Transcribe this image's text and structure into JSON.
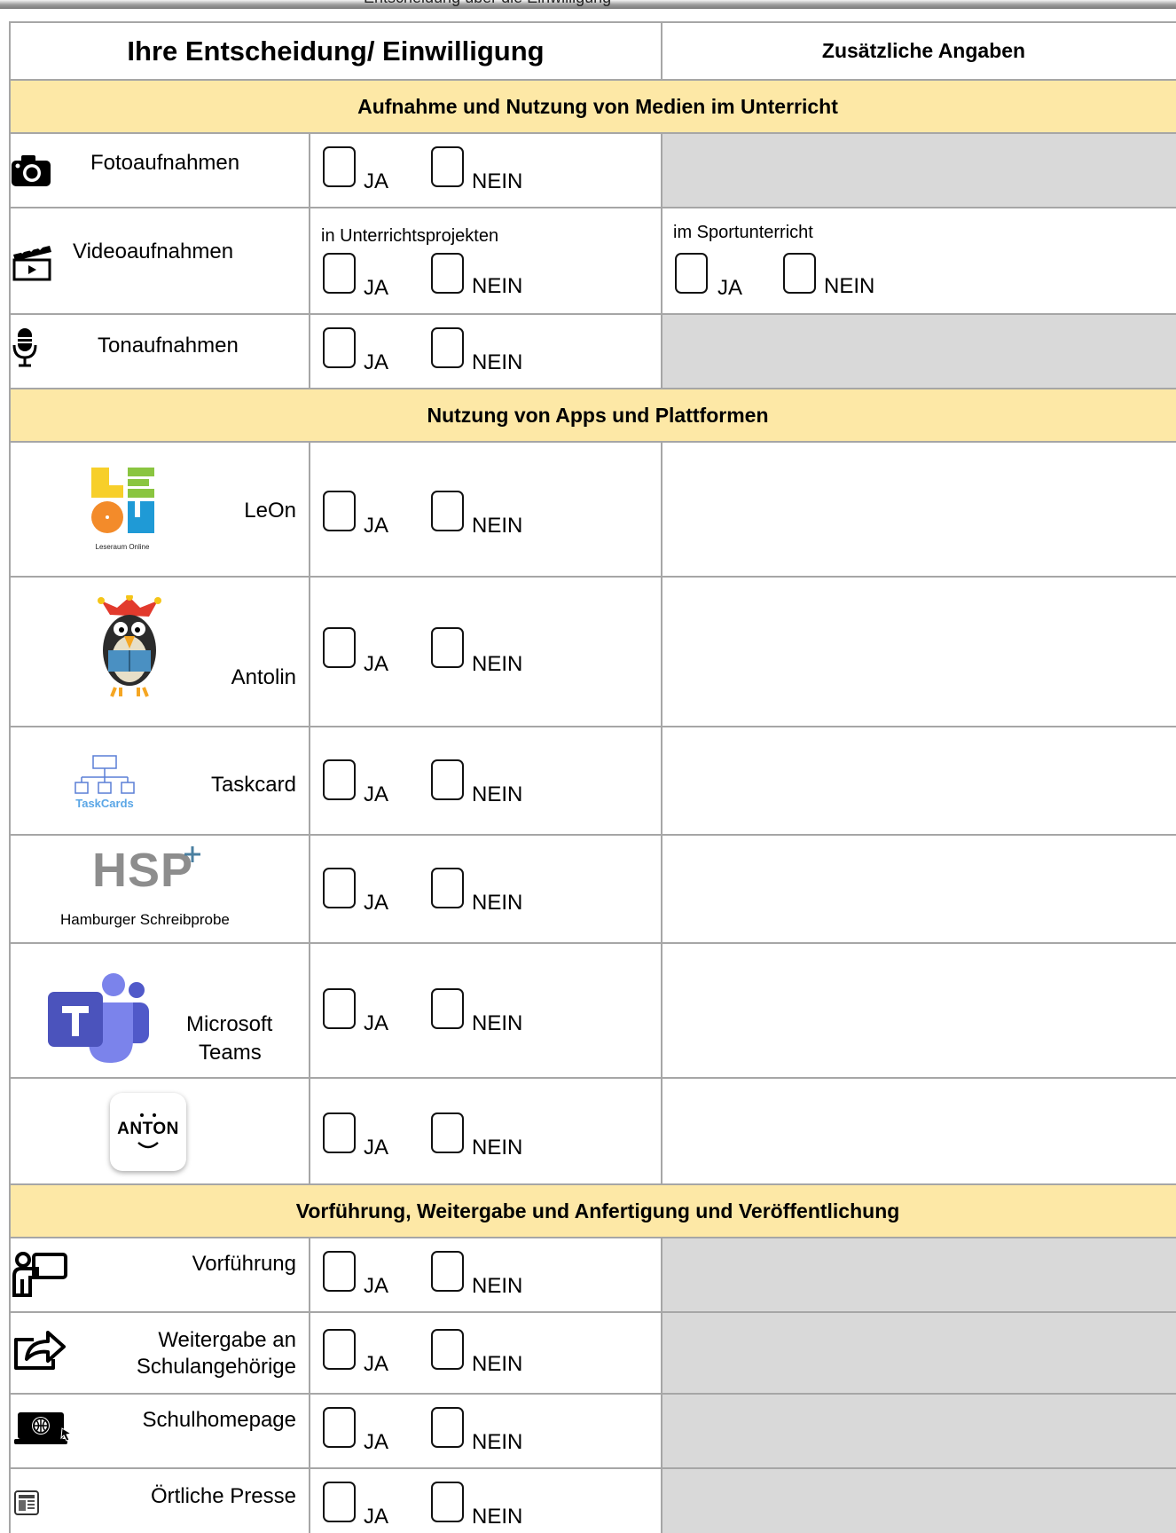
{
  "header": {
    "top_cut_text": "Entscheidung über die Einwilligung",
    "decision_col": "Ihre Entscheidung/ Einwilligung",
    "extra_col": "Zusätzliche Angaben"
  },
  "options": {
    "yes": "JA",
    "no": "NEIN"
  },
  "sections": [
    {
      "title": "Aufnahme und Nutzung von Medien im Unterricht",
      "items": [
        {
          "label": "Fotoaufnahmen",
          "icon": "camera-icon"
        },
        {
          "label": "Videoaufnahmen",
          "icon": "video-clapperboard-icon",
          "decision_note": "in Unterrichtsprojekten",
          "extra_note": "im Sportunterricht"
        },
        {
          "label": "Tonaufnahmen",
          "icon": "microphone-icon"
        }
      ]
    },
    {
      "title": "Nutzung von Apps und Plattformen",
      "items": [
        {
          "label": "LeOn",
          "icon": "leon-logo",
          "logo_caption": "Leseraum Online"
        },
        {
          "label": "Antolin",
          "icon": "antolin-raven-logo"
        },
        {
          "label": "Taskcard",
          "icon": "taskcards-logo",
          "logo_caption": "TaskCards"
        },
        {
          "label": "",
          "icon": "hsp-logo",
          "logo_text": "HSP",
          "logo_caption": "Hamburger Schreibprobe"
        },
        {
          "label": "Microsoft Teams",
          "label_line1": "Microsoft",
          "label_line2": "Teams",
          "icon": "microsoft-teams-logo"
        },
        {
          "label": "",
          "icon": "anton-logo",
          "logo_text": "ANTON"
        }
      ]
    },
    {
      "title": "Vorführung, Weitergabe und Anfertigung und Veröffentlichung",
      "items": [
        {
          "label": "Vorführung",
          "icon": "presentation-icon"
        },
        {
          "label": "Weitergabe an Schulangehörige",
          "label_line1": "Weitergabe an",
          "label_line2": "Schulangehörige",
          "icon": "share-icon"
        },
        {
          "label": "Schulhomepage",
          "icon": "web-laptop-icon"
        },
        {
          "label": "Örtliche Presse",
          "icon": "newspaper-icon"
        }
      ]
    }
  ],
  "colors": {
    "band": "#fde8a6",
    "grey_cell": "#d9d9d9",
    "grid": "#a6a6a6"
  }
}
